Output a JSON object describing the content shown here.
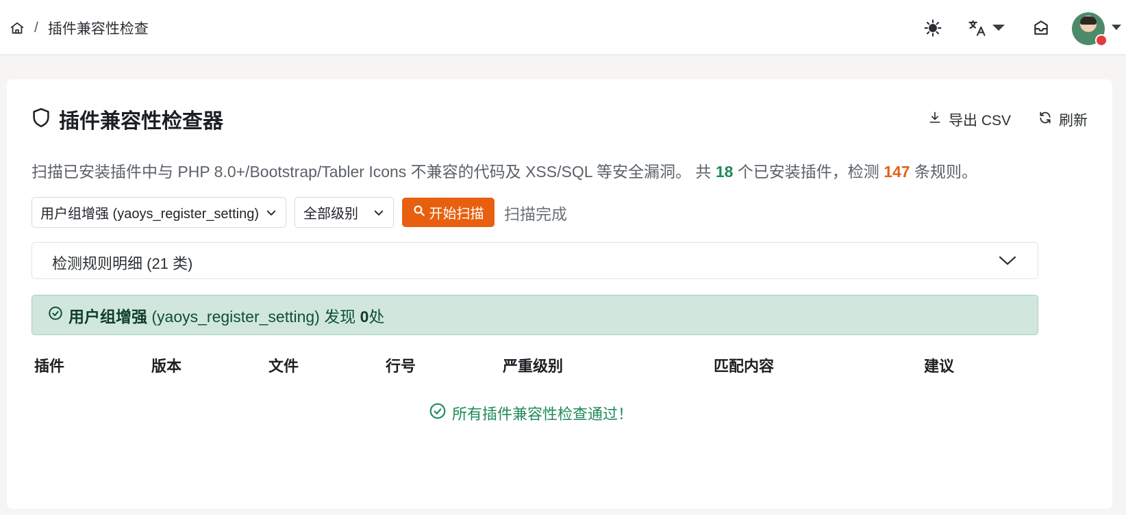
{
  "navbar": {
    "breadcrumb": {
      "page": "插件兼容性检查",
      "separator": "/"
    },
    "icons": {
      "home": "home-icon",
      "theme": "sun-icon",
      "language": "translate-icon",
      "inbox": "inbox-icon"
    }
  },
  "card": {
    "title": "插件兼容性检查器",
    "export_label": "导出 CSV",
    "refresh_label": "刷新",
    "desc_prefix": "扫描已安装插件中与 PHP 8.0+/Bootstrap/Tabler Icons 不兼容的代码及 XSS/SQL 等安全漏洞。 共 ",
    "plugin_count": "18",
    "desc_mid": " 个已安装插件，检测 ",
    "rule_count": "147",
    "desc_suffix": " 条规则。"
  },
  "controls": {
    "plugin_select": "用户组增强 (yaoys_register_setting)",
    "level_select": "全部级别",
    "scan_button": "开始扫描",
    "status": "扫描完成"
  },
  "accordion": {
    "label": "检测规则明细 (21 类)"
  },
  "alert": {
    "plugin_name": "用户组增强",
    "plugin_id": " (yaoys_register_setting) 发现 ",
    "count": "0",
    "suffix": "处"
  },
  "table": {
    "headers": [
      "插件",
      "版本",
      "文件",
      "行号",
      "严重级别",
      "匹配内容",
      "建议"
    ],
    "empty_message": "所有插件兼容性检查通过！"
  },
  "colors": {
    "accent": "#e8600f",
    "success": "#1f8a5b",
    "alert_bg": "#d1e7dd"
  }
}
